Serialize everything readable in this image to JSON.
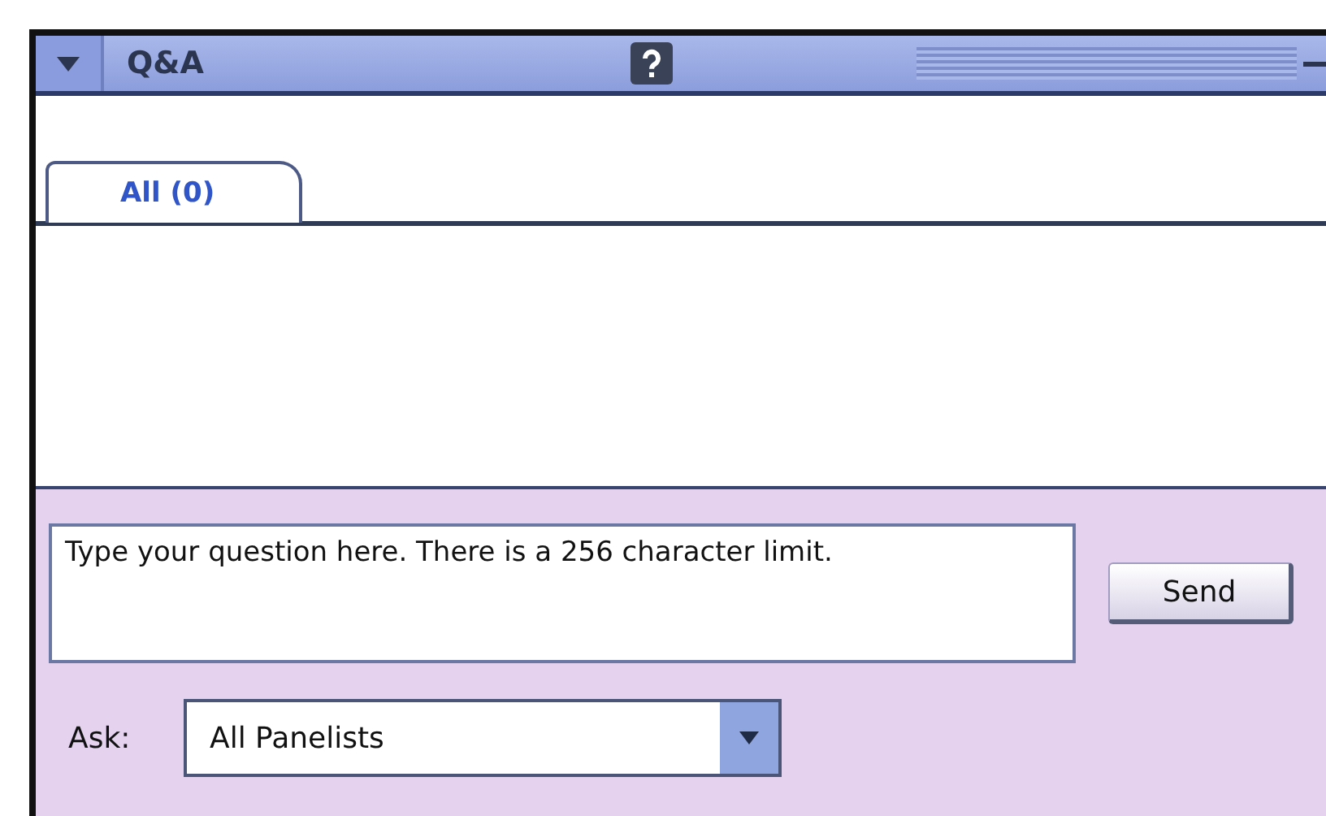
{
  "panel": {
    "title": "Q&A",
    "collapsed": false
  },
  "tabs": [
    {
      "label": "All (0)",
      "selected": true
    }
  ],
  "question": {
    "placeholder": "Type your question here. There is a 256 character limit."
  },
  "send_button": "Send",
  "ask": {
    "label": "Ask:",
    "value": "All Panelists"
  }
}
